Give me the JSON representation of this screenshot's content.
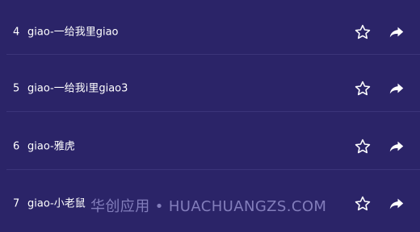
{
  "songs": [
    {
      "index": "4",
      "title": "giao-一给我里giao"
    },
    {
      "index": "5",
      "title": "giao-一给我i里giao3"
    },
    {
      "index": "6",
      "title": "giao-雅虎"
    },
    {
      "index": "7",
      "title": "giao-小老鼠"
    }
  ],
  "icons": {
    "favorite": "star-outline-icon",
    "share": "share-arrow-icon"
  },
  "colors": {
    "background": "#2b2468",
    "divider": "#3b3479",
    "text": "#ffffff"
  },
  "watermark": "华创应用 • HUACHUANGZS.COM"
}
